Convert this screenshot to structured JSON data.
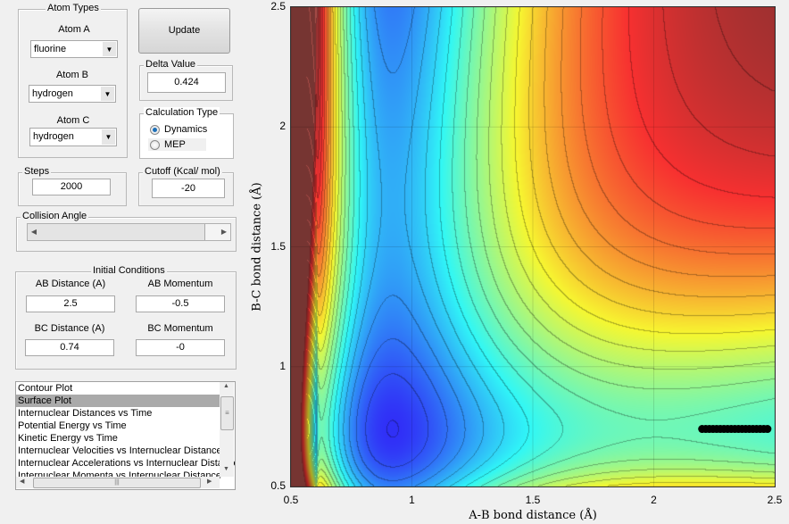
{
  "atom_types": {
    "title": "Atom Types",
    "atom_a_label": "Atom A",
    "atom_a_value": "fluorine",
    "atom_b_label": "Atom B",
    "atom_b_value": "hydrogen",
    "atom_c_label": "Atom C",
    "atom_c_value": "hydrogen"
  },
  "update_label": "Update",
  "delta": {
    "title": "Delta Value",
    "value": "0.424"
  },
  "calc_type": {
    "title": "Calculation Type",
    "options": [
      "Dynamics",
      "MEP"
    ],
    "selected": "Dynamics"
  },
  "steps": {
    "title": "Steps",
    "value": "2000"
  },
  "cutoff": {
    "title": "Cutoff (Kcal/ mol)",
    "value": "-20"
  },
  "collision_angle": {
    "title": "Collision Angle",
    "slider_fraction": 1.0
  },
  "initial_conditions": {
    "title": "Initial Conditions",
    "ab_distance_label": "AB Distance (A)",
    "ab_distance": "2.5",
    "ab_momentum_label": "AB Momentum",
    "ab_momentum": "-0.5",
    "bc_distance_label": "BC Distance (A)",
    "bc_distance": "0.74",
    "bc_momentum_label": "BC Momentum",
    "bc_momentum": "-0"
  },
  "plot_list": {
    "items": [
      "Contour Plot",
      "Surface Plot",
      "Internuclear Distances vs Time",
      "Potential Energy vs Time",
      "Kinetic Energy vs Time",
      "Internuclear Velocities vs Internuclear Distance",
      "Internuclear Accelerations vs Internuclear Distance",
      "Internuclear Momenta vs Internuclear Distance"
    ],
    "selected": "Surface Plot"
  },
  "chart_data": {
    "type": "heatmap",
    "xlabel": "A-B bond distance (Å)",
    "ylabel": "B-C bond distance (Å)",
    "xlim": [
      0.5,
      2.5
    ],
    "ylim": [
      0.5,
      2.5
    ],
    "xticks": [
      "0.5",
      "1",
      "1.5",
      "2",
      "2.5"
    ],
    "yticks": [
      "0.5",
      "1",
      "1.5",
      "2",
      "2.5"
    ],
    "colormap": "jet",
    "grid": true,
    "trajectory": {
      "y": 0.74,
      "x_range": [
        2.2,
        2.47
      ]
    },
    "colors": {
      "above_range": "#a84c48",
      "trajectory": "#000000"
    }
  }
}
